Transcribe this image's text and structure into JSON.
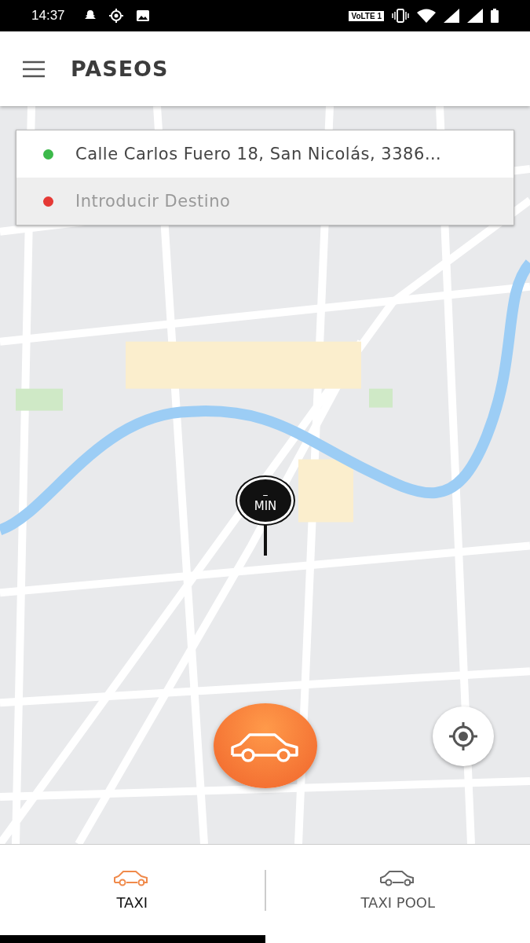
{
  "status_bar": {
    "time": "14:37",
    "network_badge": "VoLTE 1"
  },
  "header": {
    "title": "PASEOS"
  },
  "route": [
    {
      "kind": "origin",
      "value": "Calle Carlos Fuero 18, San Nicolás, 3386…",
      "color": "#3cb94a"
    },
    {
      "kind": "destination",
      "placeholder": "Introducir Destino",
      "color": "#e53935"
    }
  ],
  "pickup_pin": {
    "minutes": "–",
    "unit": "MIN"
  },
  "tabs": [
    {
      "label": "TAXI",
      "selected": true
    },
    {
      "label": "TAXI POOL",
      "selected": false
    }
  ]
}
